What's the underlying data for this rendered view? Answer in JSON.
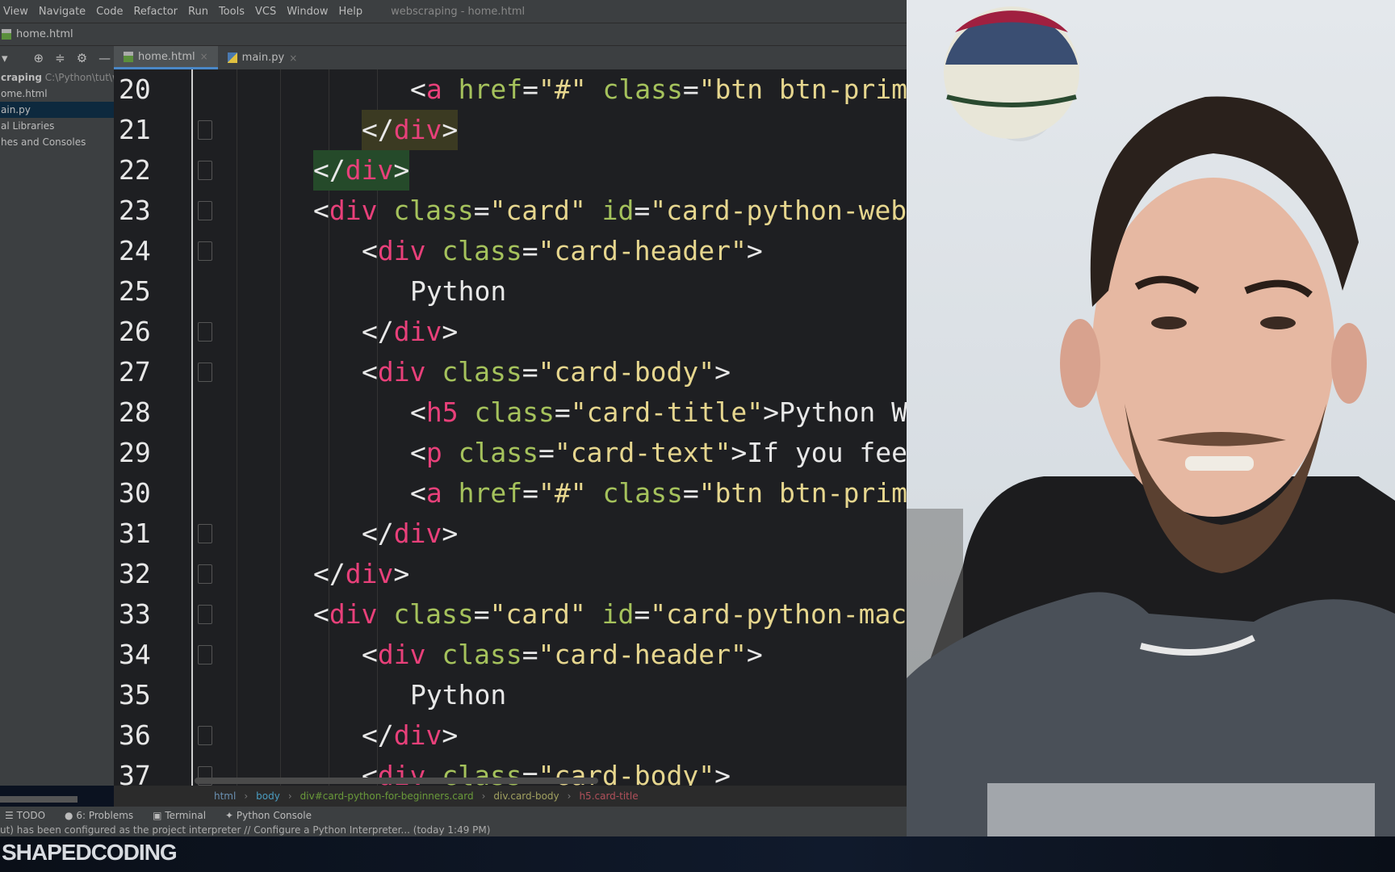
{
  "menu": {
    "items": [
      "View",
      "Navigate",
      "Code",
      "Refactor",
      "Run",
      "Tools",
      "VCS",
      "Window",
      "Help"
    ],
    "title": "webscraping - home.html"
  },
  "nav": {
    "file": "home.html"
  },
  "sidebar": {
    "project_name": "craping",
    "project_path": "C:\\Python\\tut\\wel",
    "items": [
      "ome.html",
      "ain.py",
      "al Libraries",
      "hes and Consoles"
    ],
    "selected": 1
  },
  "tabs": [
    {
      "label": "home.html",
      "active": true,
      "icon": "html-file-icon"
    },
    {
      "label": "main.py",
      "active": false,
      "icon": "python-file-icon"
    }
  ],
  "editor": {
    "lines": [
      {
        "n": "20",
        "i": 2,
        "tk": [
          [
            "p",
            "<"
          ],
          [
            "t",
            "a"
          ],
          [
            "p",
            " "
          ],
          [
            "a",
            "href"
          ],
          [
            "p",
            "="
          ],
          [
            "s",
            "\"#\""
          ],
          [
            "p",
            " "
          ],
          [
            "a",
            "class"
          ],
          [
            "p",
            "="
          ],
          [
            "s",
            "\"btn btn-prim"
          ]
        ]
      },
      {
        "n": "21",
        "i": 1,
        "hl": "hl1",
        "tk": [
          [
            "p",
            "</"
          ],
          [
            "t",
            "div"
          ],
          [
            "p",
            ">"
          ]
        ]
      },
      {
        "n": "22",
        "i": 0,
        "hl": "hl2",
        "tk": [
          [
            "p",
            "</"
          ],
          [
            "t",
            "div"
          ],
          [
            "p",
            ">"
          ]
        ]
      },
      {
        "n": "23",
        "i": 0,
        "tk": [
          [
            "p",
            "<"
          ],
          [
            "t",
            "div"
          ],
          [
            "p",
            " "
          ],
          [
            "a",
            "class"
          ],
          [
            "p",
            "="
          ],
          [
            "s",
            "\"card\""
          ],
          [
            "p",
            " "
          ],
          [
            "a",
            "id"
          ],
          [
            "p",
            "="
          ],
          [
            "s",
            "\"card-python-web"
          ]
        ]
      },
      {
        "n": "24",
        "i": 1,
        "tk": [
          [
            "p",
            "<"
          ],
          [
            "t",
            "div"
          ],
          [
            "p",
            " "
          ],
          [
            "a",
            "class"
          ],
          [
            "p",
            "="
          ],
          [
            "s",
            "\"card-header\""
          ],
          [
            "p",
            ">"
          ]
        ]
      },
      {
        "n": "25",
        "i": 2,
        "tk": [
          [
            "x",
            "Python"
          ]
        ]
      },
      {
        "n": "26",
        "i": 1,
        "tk": [
          [
            "p",
            "</"
          ],
          [
            "t",
            "div"
          ],
          [
            "p",
            ">"
          ]
        ]
      },
      {
        "n": "27",
        "i": 1,
        "tk": [
          [
            "p",
            "<"
          ],
          [
            "t",
            "div"
          ],
          [
            "p",
            " "
          ],
          [
            "a",
            "class"
          ],
          [
            "p",
            "="
          ],
          [
            "s",
            "\"card-body\""
          ],
          [
            "p",
            ">"
          ]
        ]
      },
      {
        "n": "28",
        "i": 2,
        "tk": [
          [
            "p",
            "<"
          ],
          [
            "t",
            "h5"
          ],
          [
            "p",
            " "
          ],
          [
            "a",
            "class"
          ],
          [
            "p",
            "="
          ],
          [
            "s",
            "\"card-title\""
          ],
          [
            "p",
            ">"
          ],
          [
            "x",
            "Python W"
          ]
        ]
      },
      {
        "n": "29",
        "i": 2,
        "tk": [
          [
            "p",
            "<"
          ],
          [
            "t",
            "p"
          ],
          [
            "p",
            " "
          ],
          [
            "a",
            "class"
          ],
          [
            "p",
            "="
          ],
          [
            "s",
            "\"card-text\""
          ],
          [
            "p",
            ">"
          ],
          [
            "x",
            "If you fee"
          ]
        ]
      },
      {
        "n": "30",
        "i": 2,
        "tk": [
          [
            "p",
            "<"
          ],
          [
            "t",
            "a"
          ],
          [
            "p",
            " "
          ],
          [
            "a",
            "href"
          ],
          [
            "p",
            "="
          ],
          [
            "s",
            "\"#\""
          ],
          [
            "p",
            " "
          ],
          [
            "a",
            "class"
          ],
          [
            "p",
            "="
          ],
          [
            "s",
            "\"btn btn-prim"
          ]
        ]
      },
      {
        "n": "31",
        "i": 1,
        "tk": [
          [
            "p",
            "</"
          ],
          [
            "t",
            "div"
          ],
          [
            "p",
            ">"
          ]
        ]
      },
      {
        "n": "32",
        "i": 0,
        "tk": [
          [
            "p",
            "</"
          ],
          [
            "t",
            "div"
          ],
          [
            "p",
            ">"
          ]
        ]
      },
      {
        "n": "33",
        "i": 0,
        "tk": [
          [
            "p",
            "<"
          ],
          [
            "t",
            "div"
          ],
          [
            "p",
            " "
          ],
          [
            "a",
            "class"
          ],
          [
            "p",
            "="
          ],
          [
            "s",
            "\"card\""
          ],
          [
            "p",
            " "
          ],
          [
            "a",
            "id"
          ],
          [
            "p",
            "="
          ],
          [
            "s",
            "\"card-python-mac"
          ]
        ]
      },
      {
        "n": "34",
        "i": 1,
        "tk": [
          [
            "p",
            "<"
          ],
          [
            "t",
            "div"
          ],
          [
            "p",
            " "
          ],
          [
            "a",
            "class"
          ],
          [
            "p",
            "="
          ],
          [
            "s",
            "\"card-header\""
          ],
          [
            "p",
            ">"
          ]
        ]
      },
      {
        "n": "35",
        "i": 2,
        "tk": [
          [
            "x",
            "Python"
          ]
        ]
      },
      {
        "n": "36",
        "i": 1,
        "tk": [
          [
            "p",
            "</"
          ],
          [
            "t",
            "div"
          ],
          [
            "p",
            ">"
          ]
        ]
      },
      {
        "n": "37",
        "i": 1,
        "tk": [
          [
            "p",
            "<"
          ],
          [
            "t",
            "div"
          ],
          [
            "p",
            " "
          ],
          [
            "a",
            "class"
          ],
          [
            "p",
            "="
          ],
          [
            "s",
            "\"card-body\""
          ],
          [
            "p",
            ">"
          ]
        ]
      }
    ]
  },
  "breadcrumb": [
    {
      "label": "html",
      "color": "#6a8fb0"
    },
    {
      "label": "body",
      "color": "#4a9cc0"
    },
    {
      "label": "div#card-python-for-beginners.card",
      "color": "#6a9a3a"
    },
    {
      "label": "div.card-body",
      "color": "#a0a060"
    },
    {
      "label": "h5.card-title",
      "color": "#b0505a"
    }
  ],
  "toolwindows": [
    {
      "label": "TODO",
      "icon": "list-icon"
    },
    {
      "label": "6: Problems",
      "icon": "problems-icon"
    },
    {
      "label": "Terminal",
      "icon": "terminal-icon"
    },
    {
      "label": "Python Console",
      "icon": "python-console-icon"
    }
  ],
  "status": "ut) has been configured as the project interpreter // Configure a Python Interpreter... (today 1:49 PM)",
  "brand": "SHAPEDCODING",
  "colors": {
    "tag": "#e8407a",
    "attr": "#a5c25c",
    "string": "#e6d68e",
    "editor_bg": "#1e1f22",
    "ui_bg": "#3c3f41"
  }
}
